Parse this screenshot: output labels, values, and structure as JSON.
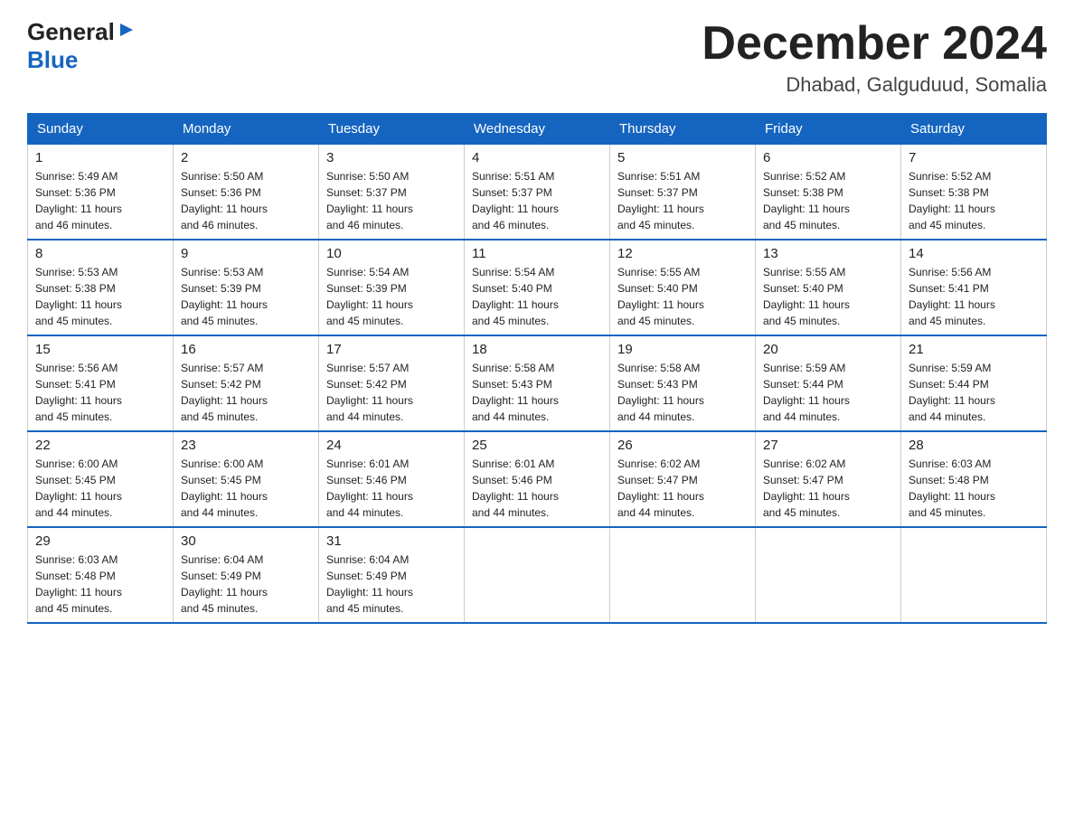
{
  "header": {
    "logo_general": "General",
    "logo_blue": "Blue",
    "month_title": "December 2024",
    "location": "Dhabad, Galguduud, Somalia"
  },
  "days_of_week": [
    "Sunday",
    "Monday",
    "Tuesday",
    "Wednesday",
    "Thursday",
    "Friday",
    "Saturday"
  ],
  "weeks": [
    [
      {
        "day": "1",
        "info": "Sunrise: 5:49 AM\nSunset: 5:36 PM\nDaylight: 11 hours\nand 46 minutes."
      },
      {
        "day": "2",
        "info": "Sunrise: 5:50 AM\nSunset: 5:36 PM\nDaylight: 11 hours\nand 46 minutes."
      },
      {
        "day": "3",
        "info": "Sunrise: 5:50 AM\nSunset: 5:37 PM\nDaylight: 11 hours\nand 46 minutes."
      },
      {
        "day": "4",
        "info": "Sunrise: 5:51 AM\nSunset: 5:37 PM\nDaylight: 11 hours\nand 46 minutes."
      },
      {
        "day": "5",
        "info": "Sunrise: 5:51 AM\nSunset: 5:37 PM\nDaylight: 11 hours\nand 45 minutes."
      },
      {
        "day": "6",
        "info": "Sunrise: 5:52 AM\nSunset: 5:38 PM\nDaylight: 11 hours\nand 45 minutes."
      },
      {
        "day": "7",
        "info": "Sunrise: 5:52 AM\nSunset: 5:38 PM\nDaylight: 11 hours\nand 45 minutes."
      }
    ],
    [
      {
        "day": "8",
        "info": "Sunrise: 5:53 AM\nSunset: 5:38 PM\nDaylight: 11 hours\nand 45 minutes."
      },
      {
        "day": "9",
        "info": "Sunrise: 5:53 AM\nSunset: 5:39 PM\nDaylight: 11 hours\nand 45 minutes."
      },
      {
        "day": "10",
        "info": "Sunrise: 5:54 AM\nSunset: 5:39 PM\nDaylight: 11 hours\nand 45 minutes."
      },
      {
        "day": "11",
        "info": "Sunrise: 5:54 AM\nSunset: 5:40 PM\nDaylight: 11 hours\nand 45 minutes."
      },
      {
        "day": "12",
        "info": "Sunrise: 5:55 AM\nSunset: 5:40 PM\nDaylight: 11 hours\nand 45 minutes."
      },
      {
        "day": "13",
        "info": "Sunrise: 5:55 AM\nSunset: 5:40 PM\nDaylight: 11 hours\nand 45 minutes."
      },
      {
        "day": "14",
        "info": "Sunrise: 5:56 AM\nSunset: 5:41 PM\nDaylight: 11 hours\nand 45 minutes."
      }
    ],
    [
      {
        "day": "15",
        "info": "Sunrise: 5:56 AM\nSunset: 5:41 PM\nDaylight: 11 hours\nand 45 minutes."
      },
      {
        "day": "16",
        "info": "Sunrise: 5:57 AM\nSunset: 5:42 PM\nDaylight: 11 hours\nand 45 minutes."
      },
      {
        "day": "17",
        "info": "Sunrise: 5:57 AM\nSunset: 5:42 PM\nDaylight: 11 hours\nand 44 minutes."
      },
      {
        "day": "18",
        "info": "Sunrise: 5:58 AM\nSunset: 5:43 PM\nDaylight: 11 hours\nand 44 minutes."
      },
      {
        "day": "19",
        "info": "Sunrise: 5:58 AM\nSunset: 5:43 PM\nDaylight: 11 hours\nand 44 minutes."
      },
      {
        "day": "20",
        "info": "Sunrise: 5:59 AM\nSunset: 5:44 PM\nDaylight: 11 hours\nand 44 minutes."
      },
      {
        "day": "21",
        "info": "Sunrise: 5:59 AM\nSunset: 5:44 PM\nDaylight: 11 hours\nand 44 minutes."
      }
    ],
    [
      {
        "day": "22",
        "info": "Sunrise: 6:00 AM\nSunset: 5:45 PM\nDaylight: 11 hours\nand 44 minutes."
      },
      {
        "day": "23",
        "info": "Sunrise: 6:00 AM\nSunset: 5:45 PM\nDaylight: 11 hours\nand 44 minutes."
      },
      {
        "day": "24",
        "info": "Sunrise: 6:01 AM\nSunset: 5:46 PM\nDaylight: 11 hours\nand 44 minutes."
      },
      {
        "day": "25",
        "info": "Sunrise: 6:01 AM\nSunset: 5:46 PM\nDaylight: 11 hours\nand 44 minutes."
      },
      {
        "day": "26",
        "info": "Sunrise: 6:02 AM\nSunset: 5:47 PM\nDaylight: 11 hours\nand 44 minutes."
      },
      {
        "day": "27",
        "info": "Sunrise: 6:02 AM\nSunset: 5:47 PM\nDaylight: 11 hours\nand 45 minutes."
      },
      {
        "day": "28",
        "info": "Sunrise: 6:03 AM\nSunset: 5:48 PM\nDaylight: 11 hours\nand 45 minutes."
      }
    ],
    [
      {
        "day": "29",
        "info": "Sunrise: 6:03 AM\nSunset: 5:48 PM\nDaylight: 11 hours\nand 45 minutes."
      },
      {
        "day": "30",
        "info": "Sunrise: 6:04 AM\nSunset: 5:49 PM\nDaylight: 11 hours\nand 45 minutes."
      },
      {
        "day": "31",
        "info": "Sunrise: 6:04 AM\nSunset: 5:49 PM\nDaylight: 11 hours\nand 45 minutes."
      },
      {
        "day": "",
        "info": ""
      },
      {
        "day": "",
        "info": ""
      },
      {
        "day": "",
        "info": ""
      },
      {
        "day": "",
        "info": ""
      }
    ]
  ]
}
